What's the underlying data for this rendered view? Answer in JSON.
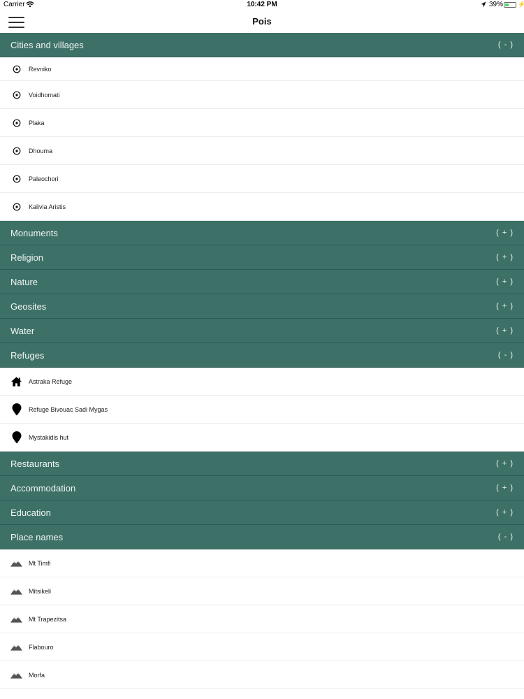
{
  "status_bar": {
    "carrier": "Carrier",
    "time": "10:42 PM",
    "battery": "39%",
    "battery_level": 0.39
  },
  "nav": {
    "title": "Pois"
  },
  "sections": [
    {
      "label": "Cities and villages",
      "toggle": "( - )",
      "items": [
        {
          "label": "Revniko",
          "icon": "target-icon"
        },
        {
          "label": "Voidhomati",
          "icon": "target-icon"
        },
        {
          "label": "Plaka",
          "icon": "target-icon"
        },
        {
          "label": "Dhouma",
          "icon": "target-icon"
        },
        {
          "label": "Paleochori",
          "icon": "target-icon"
        },
        {
          "label": "Kalivia Aristis",
          "icon": "target-icon"
        }
      ]
    },
    {
      "label": "Monuments",
      "toggle": "( + )",
      "items": []
    },
    {
      "label": "Religion",
      "toggle": "( + )",
      "items": []
    },
    {
      "label": "Nature",
      "toggle": "( + )",
      "items": []
    },
    {
      "label": "Geosites",
      "toggle": "( + )",
      "items": []
    },
    {
      "label": "Water",
      "toggle": "( + )",
      "items": []
    },
    {
      "label": "Refuges",
      "toggle": "( - )",
      "items": [
        {
          "label": "Astraka Refuge",
          "icon": "house-icon"
        },
        {
          "label": "Refuge Bivouac Sadi Mygas",
          "icon": "map-pin-icon"
        },
        {
          "label": "Mystakidis hut",
          "icon": "map-pin-icon"
        }
      ]
    },
    {
      "label": "Restaurants",
      "toggle": "( + )",
      "items": []
    },
    {
      "label": "Accommodation",
      "toggle": "( + )",
      "items": []
    },
    {
      "label": "Education",
      "toggle": "( + )",
      "items": []
    },
    {
      "label": "Place names",
      "toggle": "( - )",
      "items": [
        {
          "label": "Mt Timfi",
          "icon": "mountain-icon"
        },
        {
          "label": "Mitsikeli",
          "icon": "mountain-icon"
        },
        {
          "label": "Mt Trapezitsa",
          "icon": "mountain-icon"
        },
        {
          "label": "Flabouro",
          "icon": "mountain-icon"
        },
        {
          "label": "Morfa",
          "icon": "mountain-icon"
        }
      ]
    }
  ]
}
